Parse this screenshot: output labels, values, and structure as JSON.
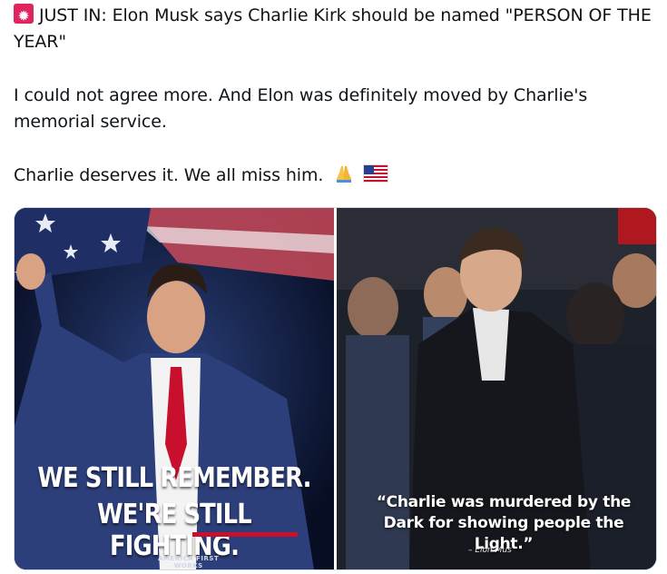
{
  "tweet": {
    "line1": "JUST IN: Elon Musk says Charlie Kirk should be named \"PERSON OF THE YEAR\"",
    "line2": "I could not agree more. And Elon was definitely moved by Charlie's memorial service.",
    "line3": "Charlie deserves it. We all miss him.",
    "icons": [
      "rotating-light-icon",
      "folded-hands-icon",
      "us-flag-icon"
    ]
  },
  "media": {
    "left": {
      "slogan_line1": "WE STILL REMEMBER.",
      "slogan_line2": "WE'RE STILL FIGHTING.",
      "logo_line1": "AMERICA FIRST",
      "logo_line2": "WORKS"
    },
    "right": {
      "quote": "“Charlie was murdered by the Dark for showing people the Light.”",
      "attribution": "– Elon Mus"
    }
  },
  "colors": {
    "accent_red": "#c8102e",
    "left_bg": "#0b1430",
    "right_bg": "#1a1d24"
  }
}
